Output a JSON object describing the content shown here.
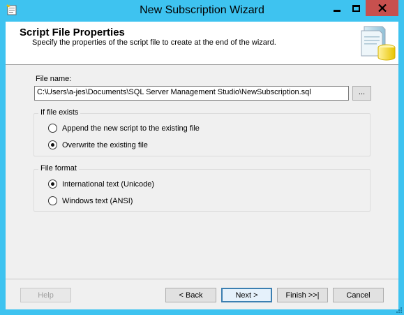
{
  "window": {
    "title": "New Subscription Wizard",
    "icons": {
      "app": "wizard-app-icon",
      "minimize": "minimize-icon",
      "maximize": "maximize-icon",
      "close": "close-icon"
    },
    "colors": {
      "frame": "#3ec3f0",
      "close_button": "#c7504e",
      "client_bg": "#f0f0f0"
    }
  },
  "header": {
    "title": "Script File Properties",
    "subtitle": "Specify the properties of the script file to create at the end of the wizard.",
    "art_icon": "script-database-icon"
  },
  "file": {
    "label": "File name:",
    "value": "C:\\Users\\a-jes\\Documents\\SQL Server Management Studio\\NewSubscription.sql",
    "browse_label": "..."
  },
  "if_file_exists": {
    "legend": "If file exists",
    "options": [
      {
        "label": "Append the new script to the existing file",
        "checked": false
      },
      {
        "label": "Overwrite the existing file",
        "checked": true
      }
    ]
  },
  "file_format": {
    "legend": "File format",
    "options": [
      {
        "label": "International text (Unicode)",
        "checked": true
      },
      {
        "label": "Windows text (ANSI)",
        "checked": false
      }
    ]
  },
  "buttons": {
    "help": "Help",
    "back": "< Back",
    "next": "Next >",
    "finish": "Finish >>|",
    "cancel": "Cancel"
  }
}
